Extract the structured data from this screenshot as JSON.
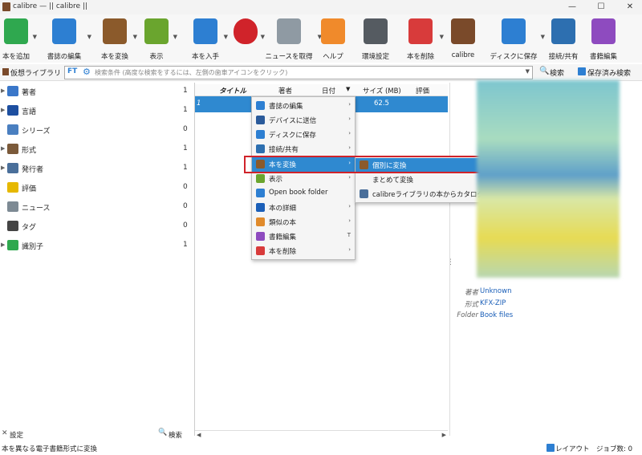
{
  "titlebar": {
    "title": "calibre — || calibre ||",
    "min": "—",
    "max": "☐",
    "close": "✕"
  },
  "toolbar": [
    {
      "label": "本を追加",
      "color": "#2fa84f",
      "icon": "add-book-icon"
    },
    {
      "label": "書誌の編集",
      "color": "#2d7fd2",
      "icon": "edit-metadata-icon"
    },
    {
      "label": "本を変換",
      "color": "#8b5a2b",
      "icon": "convert-book-icon"
    },
    {
      "label": "表示",
      "color": "#6aa52e",
      "icon": "view-book-icon"
    },
    {
      "label": "本を入手",
      "color": "#2d7fd2",
      "icon": "download-icon"
    },
    {
      "label": "",
      "color": "#d0232a",
      "icon": "heart-icon"
    },
    {
      "label": "ニュースを取得",
      "color": "#8f9aa3",
      "icon": "news-icon"
    },
    {
      "label": "ヘルプ",
      "color": "#f08a2b",
      "icon": "lifebuoy-icon"
    },
    {
      "label": "環境設定",
      "color": "#555b61",
      "icon": "preferences-icon"
    },
    {
      "label": "本を削除",
      "color": "#d83b3b",
      "icon": "trash-icon"
    },
    {
      "label": "calibre",
      "color": "#7a4a2a",
      "icon": "library-icon"
    },
    {
      "label": "ディスクに保存",
      "color": "#2d7fd2",
      "icon": "save-disk-icon"
    },
    {
      "label": "接続/共有",
      "color": "#2d6fb0",
      "icon": "connect-share-icon"
    },
    {
      "label": "書籍編集",
      "color": "#8e4bbf",
      "icon": "edit-book-icon"
    }
  ],
  "searchrow": {
    "library": "仮想ライブラリ",
    "placeholder": "検索条件 (高度な検索をするには、左側の歯車アイコンをクリック)",
    "search": "検索",
    "saved": "保存済み検索"
  },
  "tags": [
    {
      "name": "著者",
      "count": "1",
      "color": "#3a77c9"
    },
    {
      "name": "言語",
      "count": "1",
      "color": "#1d4fa0"
    },
    {
      "name": "シリーズ",
      "count": "0",
      "color": "#4a7fc0"
    },
    {
      "name": "形式",
      "count": "1",
      "color": "#7b5a3a"
    },
    {
      "name": "発行者",
      "count": "1",
      "color": "#4a6f9a"
    },
    {
      "name": "評価",
      "count": "0",
      "color": "#e6b800"
    },
    {
      "name": "ニュース",
      "count": "0",
      "color": "#7d8a94"
    },
    {
      "name": "タグ",
      "count": "0",
      "color": "#444"
    },
    {
      "name": "識別子",
      "count": "1",
      "color": "#2fa84f"
    }
  ],
  "table": {
    "headers": [
      "タイトル",
      "著者",
      "日付",
      "サイズ (MB)",
      "評価"
    ],
    "row_first": "1",
    "row_size": "62.5"
  },
  "context_menu": [
    {
      "label": "書誌の編集",
      "sub": "›",
      "color": "#2d7fd2"
    },
    {
      "label": "デバイスに送信",
      "sub": "›",
      "color": "#2a5a9a"
    },
    {
      "label": "ディスクに保存",
      "sub": "›",
      "color": "#2d7fd2"
    },
    {
      "label": "接続/共有",
      "sub": "›",
      "color": "#2d6fb0"
    },
    {
      "label": "本を変換",
      "sub": "›",
      "color": "#8b5a2b",
      "highlight": true
    },
    {
      "label": "表示",
      "sub": "›",
      "color": "#6aa52e"
    },
    {
      "label": "Open book folder",
      "sub": "",
      "color": "#2d7fd2"
    },
    {
      "label": "本の詳細",
      "sub": "›",
      "color": "#1b5fb8"
    },
    {
      "label": "類似の本",
      "sub": "›",
      "color": "#e08a2b"
    },
    {
      "label": "書籍編集",
      "sub": "T",
      "color": "#8e4bbf"
    },
    {
      "label": "本を削除",
      "sub": "›",
      "color": "#d83b3b"
    }
  ],
  "submenu": [
    {
      "label": "個別に変換",
      "color": "#8b5a2b",
      "highlight": true
    },
    {
      "label": "まとめて変換",
      "color": ""
    },
    {
      "label": "calibreライブラリの本からカタログを作成",
      "color": "#4a6f9a"
    }
  ],
  "details": [
    {
      "key": "著者",
      "value": "Unknown"
    },
    {
      "key": "形式",
      "value": "KFX-ZIP"
    },
    {
      "key": "Folder",
      "value": "Book files"
    }
  ],
  "bottom": {
    "settings": "設定",
    "search": "検索",
    "status": "本を異なる電子書籍形式に変換",
    "layout": "レイアウト",
    "jobs": "ジョブ数: 0"
  },
  "accent": "#2f89d0",
  "highlight_box": "#d0232a"
}
